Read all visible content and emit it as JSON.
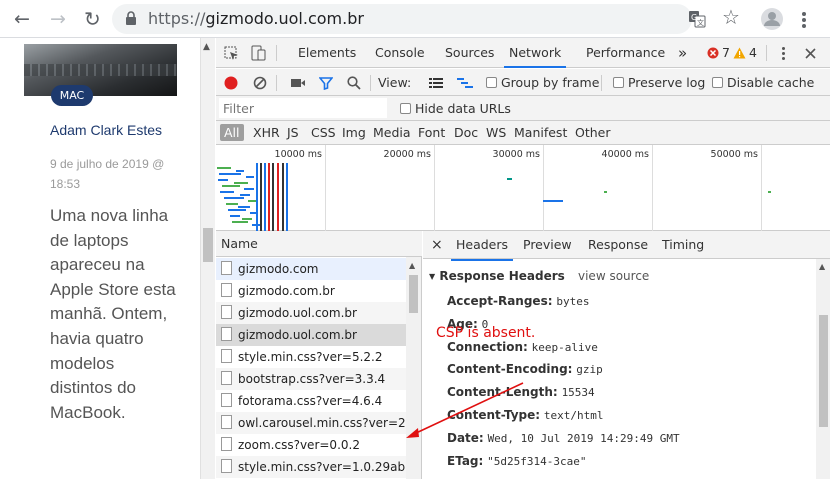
{
  "browser": {
    "back_icon": "arrow-left-icon",
    "forward_icon": "arrow-right-icon",
    "reload_icon": "reload-icon",
    "lock_icon": "lock-icon",
    "url_scheme": "https://",
    "url_host": "gizmodo.uol.com.br",
    "translate_icon": "translate-icon",
    "bookmark_icon": "star-icon",
    "profile_icon": "avatar-icon",
    "menu_icon": "kebab-menu-icon"
  },
  "article": {
    "tag": "MAC",
    "author": "Adam Clark Estes",
    "date": "9 de julho de 2019 @ 18:53",
    "excerpt": "Uma nova linha de laptops apareceu na Apple Store esta manhã. Ontem, havia quatro modelos distintos do MacBook."
  },
  "devtools": {
    "tabs": [
      "Elements",
      "Console",
      "Sources",
      "Network",
      "Performance"
    ],
    "active_tab": "Network",
    "more_tabs": "»",
    "error_count": "7",
    "warning_count": "4",
    "toolbar": {
      "view_label": "View:",
      "group_by_frame": "Group by frame",
      "preserve_log": "Preserve log",
      "disable_cache": "Disable cache"
    },
    "filter": {
      "placeholder": "Filter",
      "hide_data_urls": "Hide data URLs"
    },
    "types": [
      "All",
      "XHR",
      "JS",
      "CSS",
      "Img",
      "Media",
      "Font",
      "Doc",
      "WS",
      "Manifest",
      "Other"
    ],
    "active_type": "All",
    "overview_ticks": [
      "10000 ms",
      "20000 ms",
      "30000 ms",
      "40000 ms",
      "50000 ms"
    ],
    "request_list": {
      "column": "Name",
      "items": [
        "gizmodo.com",
        "gizmodo.com.br",
        "gizmodo.uol.com.br",
        "gizmodo.uol.com.br",
        "style.min.css?ver=5.2.2",
        "bootstrap.css?ver=3.3.4",
        "fotorama.css?ver=4.6.4",
        "owl.carousel.min.css?ver=2.2.1",
        "zoom.css?ver=0.0.2",
        "style.min.css?ver=1.0.29ab"
      ],
      "selected_index": 3
    },
    "details": {
      "close": "×",
      "tabs": [
        "Headers",
        "Preview",
        "Response",
        "Timing"
      ],
      "active_tab": "Headers",
      "section_title": "Response Headers",
      "view_source": "view source",
      "headers": [
        {
          "key": "Accept-Ranges:",
          "value": "bytes"
        },
        {
          "key": "Age:",
          "value": "0"
        },
        {
          "key": "Connection:",
          "value": "keep-alive"
        },
        {
          "key": "Content-Encoding:",
          "value": "gzip"
        },
        {
          "key": "Content-Length:",
          "value": "15534"
        },
        {
          "key": "Content-Type:",
          "value": "text/html"
        },
        {
          "key": "Date:",
          "value": "Wed, 10 Jul 2019 14:29:49 GMT"
        },
        {
          "key": "ETag:",
          "value": "\"5d25f314-3cae\""
        }
      ]
    }
  },
  "annotation": {
    "text": "CSP is absent.",
    "color": "#e01010"
  },
  "colors": {
    "accent": "#1a73e8",
    "tag_bg": "#1e3a6e",
    "record": "#e02020",
    "error": "#d93025",
    "warning": "#f2a600"
  }
}
